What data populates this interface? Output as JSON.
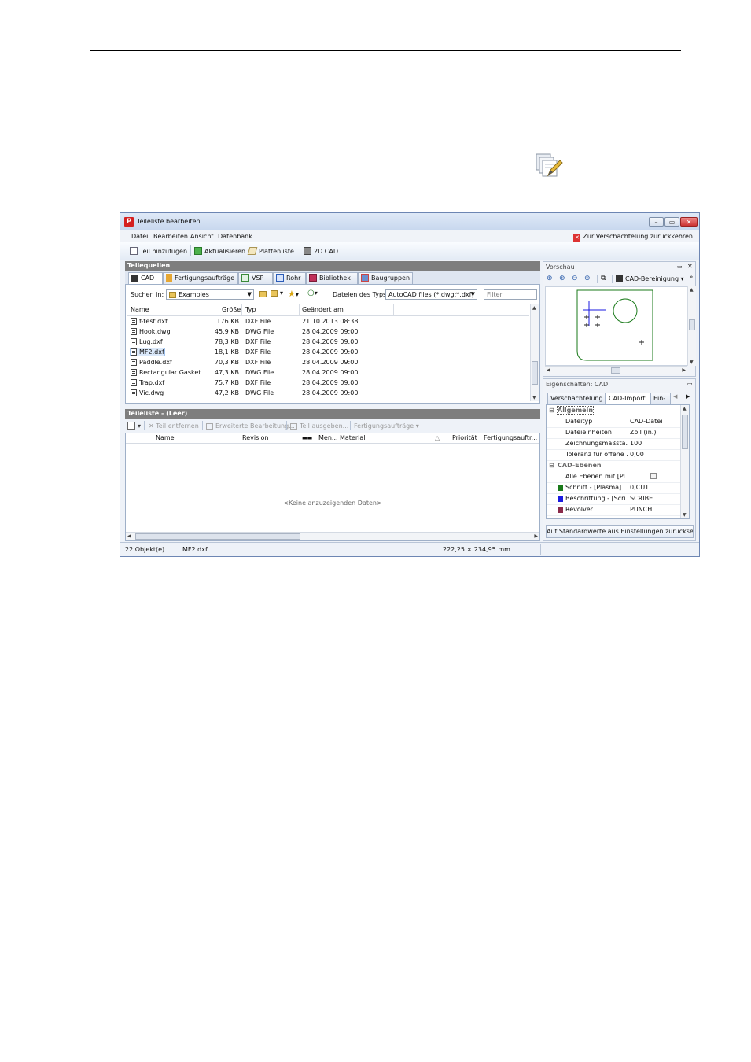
{
  "window": {
    "title": "Teileliste bearbeiten",
    "logo_letter": "P",
    "controls": {
      "minimize": "–",
      "maximize": "▭",
      "close": "✕"
    }
  },
  "menu": {
    "items": [
      "Datei",
      "Bearbeiten",
      "Ansicht",
      "Datenbank"
    ],
    "back_link": "Zur Verschachtelung zurückkehren"
  },
  "toolbar": {
    "add_part": "Teil hinzufügen",
    "refresh": "Aktualisieren",
    "plate_list": "Plattenliste...",
    "cad2d": "2D CAD..."
  },
  "sources": {
    "header": "Teilequellen",
    "tabs": [
      "CAD",
      "Fertigungsaufträge",
      "VSP",
      "Rohr",
      "Bibliothek",
      "Baugruppen"
    ],
    "active_tab": "CAD",
    "search_label": "Suchen in:",
    "search_folder": "Examples",
    "filetype_label": "Dateien des Typs:",
    "filetype_value": "AutoCAD files (*.dwg;*.dxf)",
    "filter_placeholder": "Filter",
    "columns": [
      "Name",
      "Größe",
      "Typ",
      "Geändert am"
    ],
    "files": [
      {
        "name": "f-test.dxf",
        "size": "176 KB",
        "type": "DXF File",
        "modified": "21.10.2013 08:38"
      },
      {
        "name": "Hook.dwg",
        "size": "45,9 KB",
        "type": "DWG File",
        "modified": "28.04.2009 09:00"
      },
      {
        "name": "Lug.dxf",
        "size": "78,3 KB",
        "type": "DXF File",
        "modified": "28.04.2009 09:00"
      },
      {
        "name": "MF2.dxf",
        "size": "18,1 KB",
        "type": "DXF File",
        "modified": "28.04.2009 09:00"
      },
      {
        "name": "Paddle.dxf",
        "size": "70,3 KB",
        "type": "DXF File",
        "modified": "28.04.2009 09:00"
      },
      {
        "name": "Rectangular Gasket....",
        "size": "47,3 KB",
        "type": "DWG File",
        "modified": "28.04.2009 09:00"
      },
      {
        "name": "Trap.dxf",
        "size": "75,7 KB",
        "type": "DXF File",
        "modified": "28.04.2009 09:00"
      },
      {
        "name": "Vic.dwg",
        "size": "47,2 KB",
        "type": "DWG File",
        "modified": "28.04.2009 09:00"
      }
    ]
  },
  "partlist": {
    "header": "Teileliste - (Leer)",
    "actions": [
      "Teil entfernen",
      "Erweiterte Bearbeitung...",
      "Teil ausgeben...",
      "Fertigungsaufträge"
    ],
    "columns": [
      "Name",
      "Revision",
      "Men...",
      "Material",
      "Priorität",
      "Fertigungsauftr..."
    ],
    "empty_text": "<Keine anzuzeigenden Daten>"
  },
  "preview": {
    "header": "Vorschau",
    "cleanup_label": "CAD-Bereinigung"
  },
  "properties": {
    "header": "Eigenschaften: CAD",
    "tabs": [
      "Verschachtelung",
      "CAD-Import",
      "Ein-..."
    ],
    "active_tab": "CAD-Import",
    "categories": [
      {
        "name": "Allgemein",
        "rows": [
          {
            "key": "Dateityp",
            "value": "CAD-Datei"
          },
          {
            "key": "Dateieinheiten",
            "value": "Zoll (in.)"
          },
          {
            "key": "Zeichnungsmaßsta...",
            "value": "100"
          },
          {
            "key": "Toleranz für offene ...",
            "value": "0,00"
          }
        ]
      },
      {
        "name": "CAD-Ebenen",
        "rows": [
          {
            "key": "Alle Ebenen mit [Pl...",
            "value": ""
          },
          {
            "key": "Schnitt - [Plasma]",
            "value": "0;CUT",
            "color": "#1a7a1a"
          },
          {
            "key": "Beschriftung - [Scri...",
            "value": "SCRIBE",
            "color": "#1a1ae0"
          },
          {
            "key": "Revolver",
            "value": "PUNCH",
            "color": "#8a2a4a"
          }
        ]
      }
    ],
    "reset_button": "Auf Standardwerte aus Einstellungen zurücksetzen"
  },
  "status": {
    "count": "22 Objekt(e)",
    "selected": "MF2.dxf",
    "dimensions": "222,25 × 234,95 mm"
  }
}
